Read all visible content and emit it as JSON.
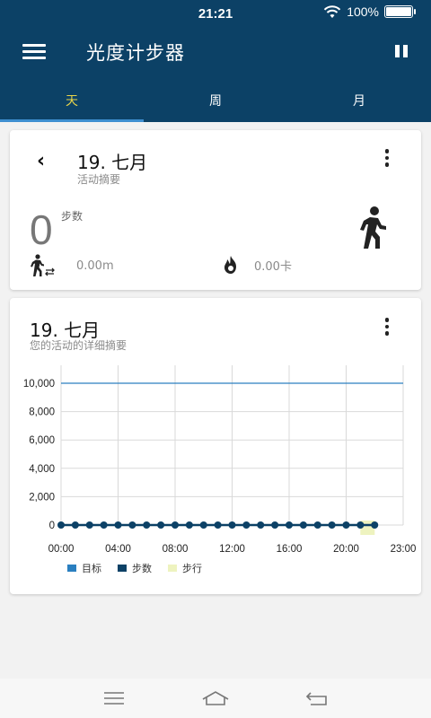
{
  "status": {
    "time": "21:21",
    "battery": "100%"
  },
  "app": {
    "title": "光度计步器"
  },
  "tabs": [
    {
      "label": "天",
      "active": true
    },
    {
      "label": "周",
      "active": false
    },
    {
      "label": "月",
      "active": false
    }
  ],
  "summary_card": {
    "date": "19. 七月",
    "subtitle": "活动摘要",
    "steps_value": "0",
    "steps_label": "步数",
    "distance": "0.00m",
    "calories": "0.00卡"
  },
  "detail_card": {
    "date": "19. 七月",
    "subtitle": "您的活动的详细摘要"
  },
  "chart_data": {
    "type": "line",
    "x_tick_labels": [
      "00:00",
      "04:00",
      "08:00",
      "12:00",
      "16:00",
      "20:00",
      "23:00"
    ],
    "y_tick_labels": [
      "0",
      "2,000",
      "4,000",
      "6,000",
      "8,000",
      "10,000"
    ],
    "ylim": [
      0,
      11000
    ],
    "xlim_hours": [
      0,
      24
    ],
    "grid": true,
    "legend_position": "bottom-left",
    "series": [
      {
        "name": "目标",
        "type": "line",
        "color": "#2a7fc0",
        "x_hours": [
          0,
          24
        ],
        "y": [
          10000,
          10000
        ]
      },
      {
        "name": "步数",
        "type": "line-markers",
        "color": "#0c4166",
        "x_hours": [
          0,
          1,
          2,
          3,
          4,
          5,
          6,
          7,
          8,
          9,
          10,
          11,
          12,
          13,
          14,
          15,
          16,
          17,
          18,
          19,
          20,
          21,
          22
        ],
        "y": [
          0,
          0,
          0,
          0,
          0,
          0,
          0,
          0,
          0,
          0,
          0,
          0,
          0,
          0,
          0,
          0,
          0,
          0,
          0,
          0,
          0,
          0,
          0
        ]
      },
      {
        "name": "步行",
        "type": "bar",
        "color": "#eef3bf",
        "x_hours": [
          21.5
        ],
        "y": [
          0
        ]
      }
    ]
  },
  "colors": {
    "appbar": "#0c4166",
    "active_tab": "#e8d44a",
    "indicator": "#3f8fd0"
  }
}
